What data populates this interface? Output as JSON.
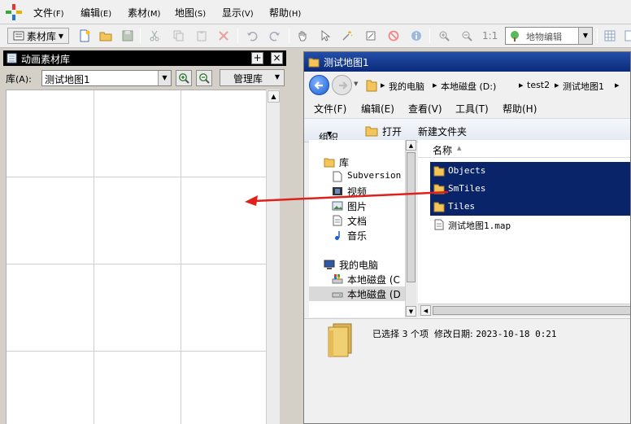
{
  "menubar": {
    "items": [
      {
        "label": "文件",
        "key": "(F)"
      },
      {
        "label": "编辑",
        "key": "(E)"
      },
      {
        "label": "素材",
        "key": "(M)"
      },
      {
        "label": "地图",
        "key": "(S)"
      },
      {
        "label": "显示",
        "key": "(V)"
      },
      {
        "label": "帮助",
        "key": "(H)"
      }
    ]
  },
  "toolbar": {
    "asset_lib_label": "素材库",
    "zoom_label": "1:1",
    "mode_select_value": "地物编辑"
  },
  "left_panel": {
    "title": "动画素材库",
    "lib_label": "库",
    "lib_key": "(A):",
    "lib_value": "测试地图1",
    "manage_label": "管理库",
    "pin_label": "+",
    "close_label": "×"
  },
  "explorer": {
    "title": "测试地图1",
    "breadcrumb": [
      "我的电脑",
      "本地磁盘 (D:)",
      "test2",
      "测试地图1"
    ],
    "menu": [
      "文件(F)",
      "编辑(E)",
      "查看(V)",
      "工具(T)",
      "帮助(H)"
    ],
    "commands": {
      "organize": "组织",
      "open": "打开",
      "new_folder": "新建文件夹"
    },
    "nav_items": [
      {
        "label": "库",
        "icon": "library-icon"
      },
      {
        "label": "Subversion",
        "icon": "document-icon"
      },
      {
        "label": "视频",
        "icon": "video-icon"
      },
      {
        "label": "图片",
        "icon": "picture-icon"
      },
      {
        "label": "文档",
        "icon": "document-icon"
      },
      {
        "label": "音乐",
        "icon": "music-icon"
      },
      {
        "label": "我的电脑",
        "icon": "computer-icon"
      },
      {
        "label": "本地磁盘 (C",
        "icon": "drive-icon"
      },
      {
        "label": "本地磁盘 (D",
        "icon": "drive-icon"
      }
    ],
    "column_name": "名称",
    "files": [
      {
        "name": "Objects",
        "type": "folder",
        "selected": true
      },
      {
        "name": "SmTiles",
        "type": "folder",
        "selected": true
      },
      {
        "name": "Tiles",
        "type": "folder",
        "selected": true
      },
      {
        "name": "测试地图1.map",
        "type": "file",
        "selected": false
      }
    ],
    "status": {
      "selected": "已选择 3 个项",
      "modified_label": "修改日期:",
      "modified_value": "2023-10-18 0:21"
    }
  },
  "colors": {
    "selection": "#0a246a",
    "drag_arrow": "#e0201a",
    "panel_title": "#000000"
  }
}
